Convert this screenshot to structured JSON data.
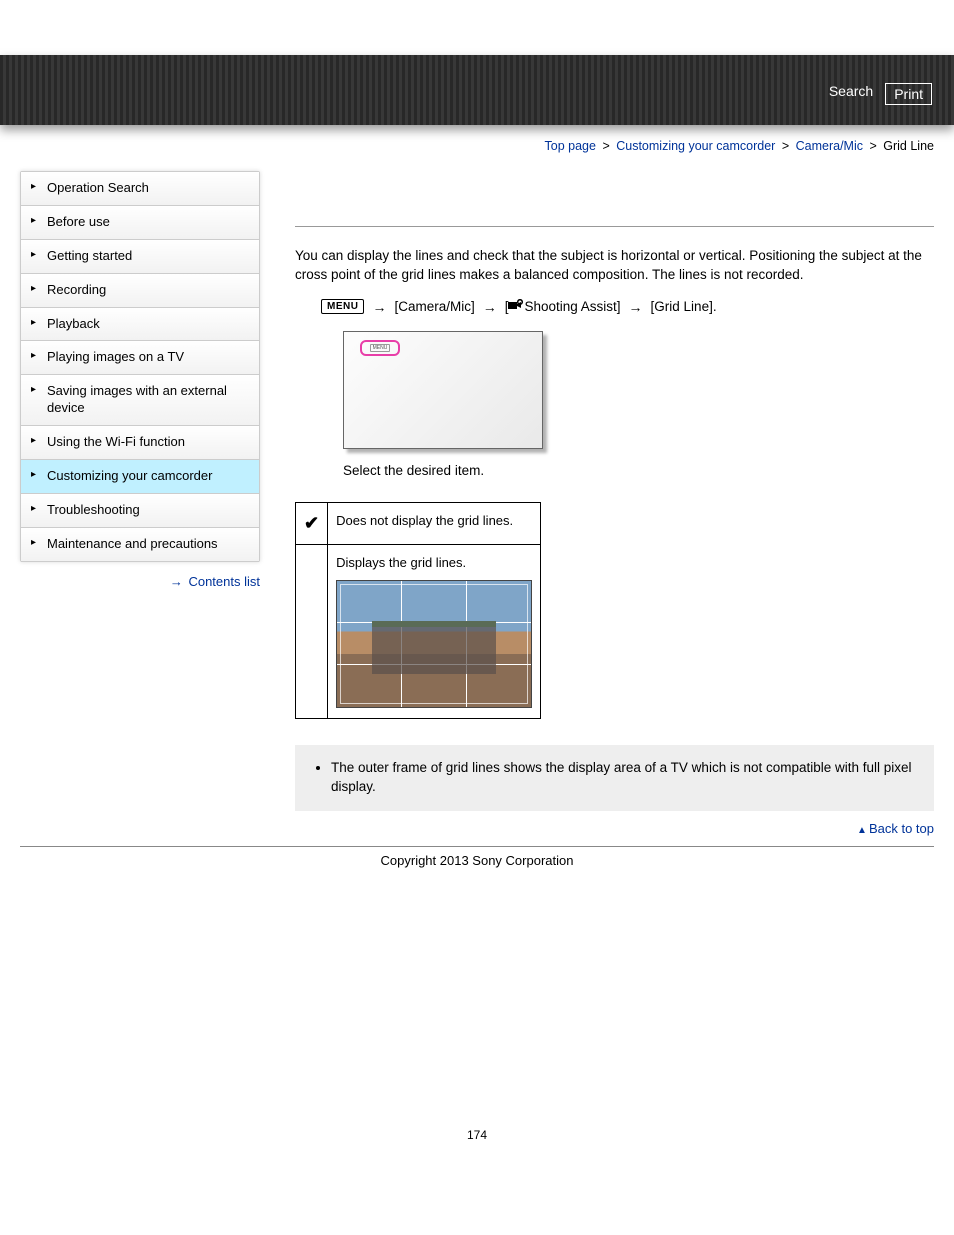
{
  "header": {
    "search": "Search",
    "print": "Print"
  },
  "breadcrumb": {
    "items": [
      "Top page",
      "Customizing your camcorder",
      "Camera/Mic"
    ],
    "current": "Grid Line",
    "sep": ">"
  },
  "sidebar": {
    "items": [
      "Operation Search",
      "Before use",
      "Getting started",
      "Recording",
      "Playback",
      "Playing images on a TV",
      "Saving images with an external device",
      "Using the Wi-Fi function",
      "Customizing your camcorder",
      "Troubleshooting",
      "Maintenance and precautions"
    ],
    "active_index": 8,
    "contents_list": "Contents list"
  },
  "main": {
    "intro": "You can display the lines and check that the subject is horizontal or vertical. Positioning the subject at the cross point of the grid lines makes a balanced composition. The lines is not recorded.",
    "menu_label": "MENU",
    "path1": "[Camera/Mic]",
    "path2_a": "[",
    "path2_b": "Shooting Assist]",
    "path3": "[Grid Line].",
    "select_text": "Select the desired item.",
    "opt_off": "Does not display the grid lines.",
    "opt_on": "Displays the grid lines.",
    "note": "The outer frame of grid lines shows the display area of a TV which is not compatible with full pixel display."
  },
  "footer": {
    "back_to_top": "Back to top",
    "copyright": "Copyright 2013 Sony Corporation",
    "page_number": "174"
  }
}
